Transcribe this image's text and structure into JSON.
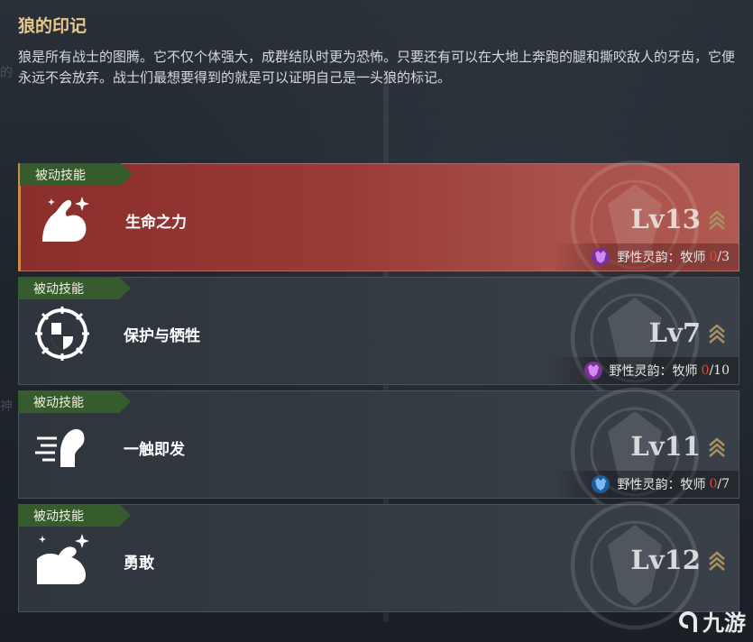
{
  "header": {
    "title": "狼的印记",
    "description": "狼是所有战士的图腾。它不仅个体强大，成群结队时更为恐怖。只要还有可以在大地上奔跑的腿和撕咬敌人的牙齿，它便永远不会放弃。战士们最想要得到的就是可以证明自己是一头狼的标记。"
  },
  "skills": [
    {
      "tag": "被动技能",
      "name": "生命之力",
      "level": "Lv13",
      "resonance_label": "野性灵韵：牧师",
      "resonance_current": "0",
      "resonance_total": "/3",
      "resonance_icon": "purple-wolf-icon",
      "selected": true
    },
    {
      "tag": "被动技能",
      "name": "保护与牺牲",
      "level": "Lv7",
      "resonance_label": "野性灵韵：牧师",
      "resonance_current": "0",
      "resonance_total": "/10",
      "resonance_icon": "purple-wolf-icon",
      "selected": false
    },
    {
      "tag": "被动技能",
      "name": "一触即发",
      "level": "Lv11",
      "resonance_label": "野性灵韵：牧师",
      "resonance_current": "0",
      "resonance_total": "/7",
      "resonance_icon": "blue-wolf-icon",
      "selected": false
    },
    {
      "tag": "被动技能",
      "name": "勇敢",
      "level": "Lv12",
      "selected": false
    }
  ],
  "watermark": {
    "text": "九游"
  },
  "colors": {
    "title": "#e8c88a",
    "selected_card": "#9a3a36",
    "tag_green": "#365c2e",
    "count_red": "#e04a3a"
  }
}
